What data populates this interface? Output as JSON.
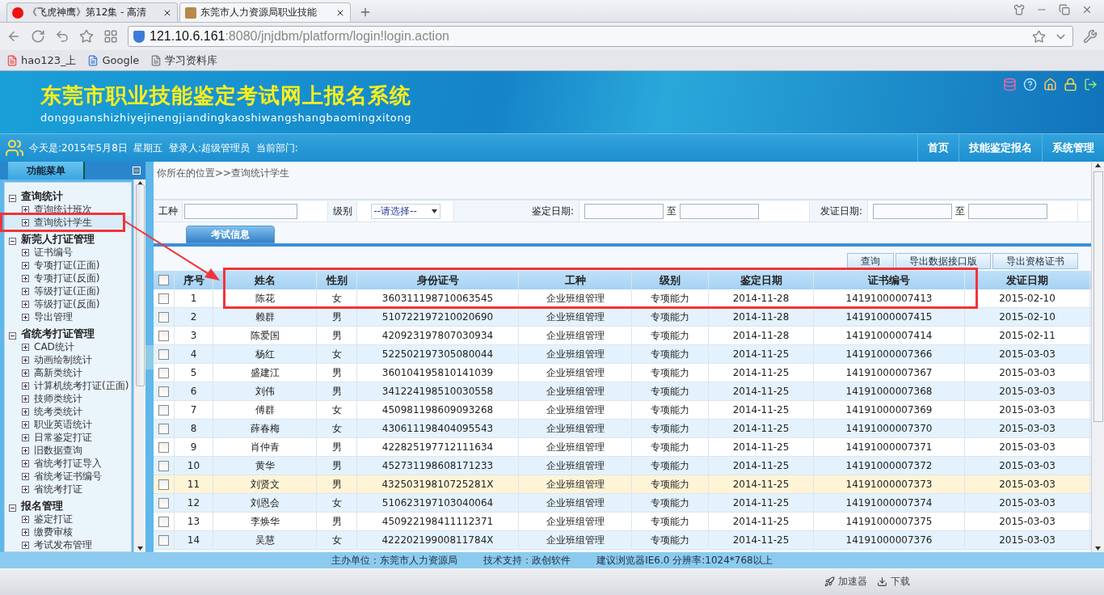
{
  "browser": {
    "tabs": [
      {
        "title": "《飞虎神鹰》第12集 - 高清",
        "selected": false
      },
      {
        "title": "东莞市人力资源局职业技能",
        "selected": true
      }
    ],
    "url_host": "121.10.6.161",
    "url_rest": ":8080/jnjdbm/platform/login!login.action",
    "bookmarks": [
      "hao123_上",
      "Google",
      "学习资料库"
    ]
  },
  "header": {
    "title": "东莞市职业技能鉴定考试网上报名系统",
    "subtitle": "dongguanshizhiyejinengjiandingkaoshiwangshangbaomingxitong"
  },
  "info_bar": {
    "text": "今天是:2015年5月8日  星期五  登录人:超级管理员  当前部门:",
    "nav": [
      "首页",
      "技能鉴定报名",
      "系统管理"
    ]
  },
  "sidebar": {
    "title": "功能菜单",
    "groups": [
      {
        "label": "查询统计",
        "expanded": true,
        "children": [
          {
            "label": "查询统计班次",
            "selected": false
          },
          {
            "label": "查询统计学生",
            "selected": true
          }
        ]
      },
      {
        "label": "新莞人打证管理",
        "expanded": true,
        "children": [
          {
            "label": "证书编号",
            "selected": false
          },
          {
            "label": "专项打证(正面)",
            "selected": false
          },
          {
            "label": "专项打证(反面)",
            "selected": false
          },
          {
            "label": "等级打证(正面)",
            "selected": false
          },
          {
            "label": "等级打证(反面)",
            "selected": false
          },
          {
            "label": "导出管理",
            "selected": false
          }
        ]
      },
      {
        "label": "省统考打证管理",
        "expanded": true,
        "children": [
          {
            "label": "CAD统计",
            "selected": false
          },
          {
            "label": "动画绘制统计",
            "selected": false
          },
          {
            "label": "高新类统计",
            "selected": false
          },
          {
            "label": "计算机统考打证(正面)",
            "selected": false
          },
          {
            "label": "技师类统计",
            "selected": false
          },
          {
            "label": "统考类统计",
            "selected": false
          },
          {
            "label": "职业英语统计",
            "selected": false
          },
          {
            "label": "日常鉴定打证",
            "selected": false
          },
          {
            "label": "旧数据查询",
            "selected": false
          },
          {
            "label": "省统考打证导入",
            "selected": false
          },
          {
            "label": "省统考证书编号",
            "selected": false
          },
          {
            "label": "省统考打证",
            "selected": false
          }
        ]
      },
      {
        "label": "报名管理",
        "expanded": true,
        "children": [
          {
            "label": "鉴定打证",
            "selected": false
          },
          {
            "label": "缴费审核",
            "selected": false
          },
          {
            "label": "考试发布管理",
            "selected": false
          }
        ]
      }
    ]
  },
  "breadcrumb": "你所在的位置>>查询统计学生",
  "filters": {
    "job_label": "工种",
    "level_label": "级别",
    "level_value": "--请选择--",
    "exam_date_label": "鉴定日期:",
    "issue_date_label": "发证日期:",
    "to": [
      "至",
      "至"
    ]
  },
  "tabs": [
    {
      "label": "考试信息",
      "selected": true
    }
  ],
  "buttons": [
    "查询",
    "导出数据接口版",
    "导出资格证书"
  ],
  "table": {
    "select_all_checked": false,
    "columns": [
      "序号",
      "姓名",
      "性别",
      "身份证号",
      "工种",
      "级别",
      "鉴定日期",
      "证书编号",
      "发证日期"
    ],
    "rows": [
      {
        "checked": false,
        "highlighted": false,
        "cells": [
          "1",
          "陈花",
          "女",
          "360311198710063545",
          "企业班组管理",
          "专项能力",
          "2014-11-28",
          "14191000007413",
          "2015-02-10"
        ]
      },
      {
        "checked": false,
        "highlighted": false,
        "cells": [
          "2",
          "赖群",
          "男",
          "510722197210020690",
          "企业班组管理",
          "专项能力",
          "2014-11-28",
          "14191000007415",
          "2015-02-10"
        ]
      },
      {
        "checked": false,
        "highlighted": false,
        "cells": [
          "3",
          "陈爱国",
          "男",
          "420923197807030934",
          "企业班组管理",
          "专项能力",
          "2014-11-28",
          "14191000007414",
          "2015-02-11"
        ]
      },
      {
        "checked": false,
        "highlighted": false,
        "cells": [
          "4",
          "杨红",
          "女",
          "522502197305080044",
          "企业班组管理",
          "专项能力",
          "2014-11-25",
          "14191000007366",
          "2015-03-03"
        ]
      },
      {
        "checked": false,
        "highlighted": false,
        "cells": [
          "5",
          "盛建江",
          "男",
          "360104195810141039",
          "企业班组管理",
          "专项能力",
          "2014-11-25",
          "14191000007367",
          "2015-03-03"
        ]
      },
      {
        "checked": false,
        "highlighted": false,
        "cells": [
          "6",
          "刘伟",
          "男",
          "341224198510030558",
          "企业班组管理",
          "专项能力",
          "2014-11-25",
          "14191000007368",
          "2015-03-03"
        ]
      },
      {
        "checked": false,
        "highlighted": false,
        "cells": [
          "7",
          "傅群",
          "女",
          "450981198609093268",
          "企业班组管理",
          "专项能力",
          "2014-11-25",
          "14191000007369",
          "2015-03-03"
        ]
      },
      {
        "checked": false,
        "highlighted": false,
        "cells": [
          "8",
          "薛春梅",
          "女",
          "430611198404095543",
          "企业班组管理",
          "专项能力",
          "2014-11-25",
          "14191000007370",
          "2015-03-03"
        ]
      },
      {
        "checked": false,
        "highlighted": false,
        "cells": [
          "9",
          "肖仲青",
          "男",
          "422825197712111634",
          "企业班组管理",
          "专项能力",
          "2014-11-25",
          "14191000007371",
          "2015-03-03"
        ]
      },
      {
        "checked": false,
        "highlighted": false,
        "cells": [
          "10",
          "黄华",
          "男",
          "452731198608171233",
          "企业班组管理",
          "专项能力",
          "2014-11-25",
          "14191000007372",
          "2015-03-03"
        ]
      },
      {
        "checked": false,
        "highlighted": true,
        "cells": [
          "11",
          "刘贤文",
          "男",
          "43250319810725281X",
          "企业班组管理",
          "专项能力",
          "2014-11-25",
          "14191000007373",
          "2015-03-03"
        ]
      },
      {
        "checked": false,
        "highlighted": false,
        "cells": [
          "12",
          "刘恩会",
          "女",
          "510623197103040064",
          "企业班组管理",
          "专项能力",
          "2014-11-25",
          "14191000007374",
          "2015-03-03"
        ]
      },
      {
        "checked": false,
        "highlighted": false,
        "cells": [
          "13",
          "李焕华",
          "男",
          "450922198411112371",
          "企业班组管理",
          "专项能力",
          "2014-11-25",
          "14191000007375",
          "2015-03-03"
        ]
      },
      {
        "checked": false,
        "highlighted": false,
        "cells": [
          "14",
          "吴慧",
          "女",
          "42220219900811784X",
          "企业班组管理",
          "专项能力",
          "2014-11-25",
          "14191000007376",
          "2015-03-03"
        ]
      }
    ]
  },
  "footer": [
    "主办单位：东莞市人力资源局",
    "技术支持：政创软件",
    "建议浏览器IE6.0 分辨率:1024*768以上"
  ],
  "status_bar": [
    "加速器",
    "下载"
  ]
}
